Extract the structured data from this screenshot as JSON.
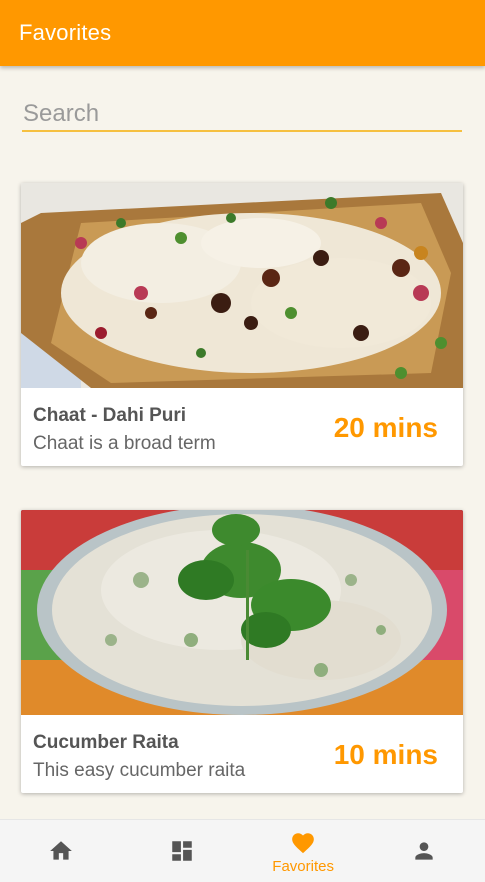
{
  "app_bar": {
    "title": "Favorites"
  },
  "search": {
    "placeholder": "Search"
  },
  "recipes": [
    {
      "title": "Chaat - Dahi Puri",
      "description": "Chaat is a broad term",
      "time": "20 mins"
    },
    {
      "title": "Cucumber Raita",
      "description": "This easy cucumber raita",
      "time": "10 mins"
    }
  ],
  "bottom_nav": {
    "items": [
      {
        "icon": "home-icon",
        "label": ""
      },
      {
        "icon": "dashboard-icon",
        "label": ""
      },
      {
        "icon": "heart-icon",
        "label": "Favorites",
        "active": true
      },
      {
        "icon": "person-icon",
        "label": ""
      }
    ]
  },
  "colors": {
    "accent": "#ff9800",
    "background": "#f7f4ec",
    "search_underline": "#f6c040",
    "inactive_icon": "#555555"
  }
}
